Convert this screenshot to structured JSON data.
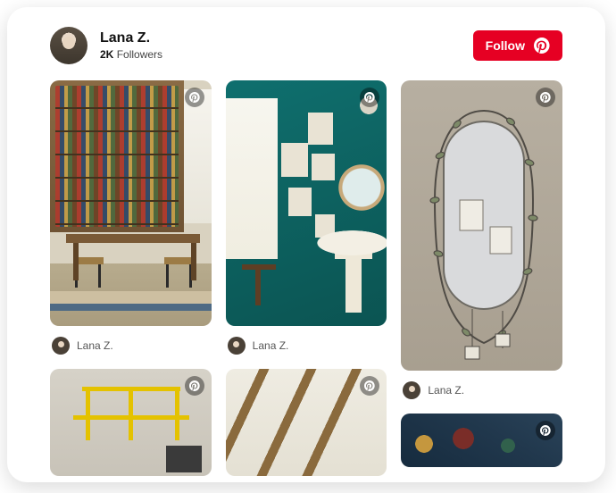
{
  "profile": {
    "name": "Lana Z.",
    "follower_count": "2K",
    "followers_label": "Followers"
  },
  "actions": {
    "follow_label": "Follow"
  },
  "columns": [
    {
      "pins": [
        {
          "author": "Lana Z.",
          "icon": "pinterest-icon"
        },
        {
          "author": "",
          "icon": "pinterest-icon"
        }
      ]
    },
    {
      "pins": [
        {
          "author": "Lana Z.",
          "icon": "pinterest-icon"
        },
        {
          "author": "",
          "icon": "pinterest-icon"
        }
      ]
    },
    {
      "pins": [
        {
          "author": "Lana Z.",
          "icon": "pinterest-icon"
        },
        {
          "author": "",
          "icon": "pinterest-icon"
        }
      ]
    }
  ]
}
